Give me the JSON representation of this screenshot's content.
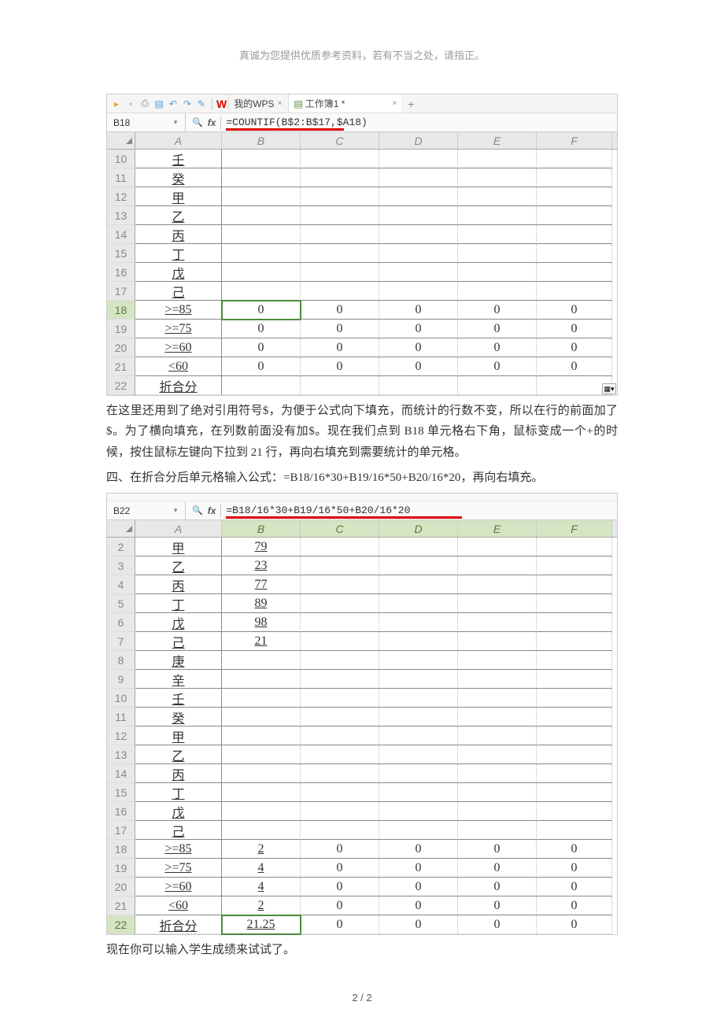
{
  "header_note": "真诚为您提供优质参考资料，若有不当之处，请指正。",
  "ss1": {
    "tabs": {
      "wps": "W",
      "wps_label": "我的WPS",
      "file": "工作簿1 *"
    },
    "name_box": "B18",
    "formula": "=COUNTIF(B$2:B$17,$A18)",
    "col_headers": [
      "A",
      "B",
      "C",
      "D",
      "E",
      "F"
    ],
    "rows": [
      {
        "n": "10",
        "a": "壬",
        "b": "",
        "c": "",
        "d": "",
        "e": "",
        "f": ""
      },
      {
        "n": "11",
        "a": "癸",
        "b": "",
        "c": "",
        "d": "",
        "e": "",
        "f": ""
      },
      {
        "n": "12",
        "a": "甲",
        "b": "",
        "c": "",
        "d": "",
        "e": "",
        "f": ""
      },
      {
        "n": "13",
        "a": "乙",
        "b": "",
        "c": "",
        "d": "",
        "e": "",
        "f": ""
      },
      {
        "n": "14",
        "a": "丙",
        "b": "",
        "c": "",
        "d": "",
        "e": "",
        "f": ""
      },
      {
        "n": "15",
        "a": "丁",
        "b": "",
        "c": "",
        "d": "",
        "e": "",
        "f": ""
      },
      {
        "n": "16",
        "a": "戊",
        "b": "",
        "c": "",
        "d": "",
        "e": "",
        "f": ""
      },
      {
        "n": "17",
        "a": "己",
        "b": "",
        "c": "",
        "d": "",
        "e": "",
        "f": ""
      },
      {
        "n": "18",
        "a": ">=85",
        "b": "0",
        "c": "0",
        "d": "0",
        "e": "0",
        "f": "0"
      },
      {
        "n": "19",
        "a": ">=75",
        "b": "0",
        "c": "0",
        "d": "0",
        "e": "0",
        "f": "0"
      },
      {
        "n": "20",
        "a": ">=60",
        "b": "0",
        "c": "0",
        "d": "0",
        "e": "0",
        "f": "0"
      },
      {
        "n": "21",
        "a": "<60",
        "b": "0",
        "c": "0",
        "d": "0",
        "e": "0",
        "f": "0"
      },
      {
        "n": "22",
        "a": "折合分",
        "b": "",
        "c": "",
        "d": "",
        "e": "",
        "f": ""
      }
    ]
  },
  "para1": "在这里还用到了绝对引用符号$，为便于公式向下填充，而统计的行数不变，所以在行的前面加了$。为了横向填充，在列数前面没有加$。现在我们点到 B18 单元格右下角，鼠标变成一个+的时候，按住鼠标左键向下拉到 21 行，再向右填充到需要统计的单元格。",
  "para2": "四、在折合分后单元格输入公式：=B18/16*30+B19/16*50+B20/16*20，再向右填充。",
  "ss2": {
    "name_box": "B22",
    "formula": "=B18/16*30+B19/16*50+B20/16*20",
    "col_headers": [
      "A",
      "B",
      "C",
      "D",
      "E",
      "F"
    ],
    "rows": [
      {
        "n": "2",
        "a": "甲",
        "b": "79",
        "c": "",
        "d": "",
        "e": "",
        "f": ""
      },
      {
        "n": "3",
        "a": "乙",
        "b": "23",
        "c": "",
        "d": "",
        "e": "",
        "f": ""
      },
      {
        "n": "4",
        "a": "丙",
        "b": "77",
        "c": "",
        "d": "",
        "e": "",
        "f": ""
      },
      {
        "n": "5",
        "a": "丁",
        "b": "89",
        "c": "",
        "d": "",
        "e": "",
        "f": ""
      },
      {
        "n": "6",
        "a": "戊",
        "b": "98",
        "c": "",
        "d": "",
        "e": "",
        "f": ""
      },
      {
        "n": "7",
        "a": "己",
        "b": "21",
        "c": "",
        "d": "",
        "e": "",
        "f": ""
      },
      {
        "n": "8",
        "a": "庚",
        "b": "",
        "c": "",
        "d": "",
        "e": "",
        "f": ""
      },
      {
        "n": "9",
        "a": "辛",
        "b": "",
        "c": "",
        "d": "",
        "e": "",
        "f": ""
      },
      {
        "n": "10",
        "a": "壬",
        "b": "",
        "c": "",
        "d": "",
        "e": "",
        "f": ""
      },
      {
        "n": "11",
        "a": "癸",
        "b": "",
        "c": "",
        "d": "",
        "e": "",
        "f": ""
      },
      {
        "n": "12",
        "a": "甲",
        "b": "",
        "c": "",
        "d": "",
        "e": "",
        "f": ""
      },
      {
        "n": "13",
        "a": "乙",
        "b": "",
        "c": "",
        "d": "",
        "e": "",
        "f": ""
      },
      {
        "n": "14",
        "a": "丙",
        "b": "",
        "c": "",
        "d": "",
        "e": "",
        "f": ""
      },
      {
        "n": "15",
        "a": "丁",
        "b": "",
        "c": "",
        "d": "",
        "e": "",
        "f": ""
      },
      {
        "n": "16",
        "a": "戊",
        "b": "",
        "c": "",
        "d": "",
        "e": "",
        "f": ""
      },
      {
        "n": "17",
        "a": "己",
        "b": "",
        "c": "",
        "d": "",
        "e": "",
        "f": ""
      },
      {
        "n": "18",
        "a": ">=85",
        "b": "2",
        "c": "0",
        "d": "0",
        "e": "0",
        "f": "0"
      },
      {
        "n": "19",
        "a": ">=75",
        "b": "4",
        "c": "0",
        "d": "0",
        "e": "0",
        "f": "0"
      },
      {
        "n": "20",
        "a": ">=60",
        "b": "4",
        "c": "0",
        "d": "0",
        "e": "0",
        "f": "0"
      },
      {
        "n": "21",
        "a": "<60",
        "b": "2",
        "c": "0",
        "d": "0",
        "e": "0",
        "f": "0"
      },
      {
        "n": "22",
        "a": "折合分",
        "b": "21.25",
        "c": "0",
        "d": "0",
        "e": "0",
        "f": "0"
      }
    ]
  },
  "para3": "现在你可以输入学生成绩来试试了。",
  "page_num": "2 / 2"
}
